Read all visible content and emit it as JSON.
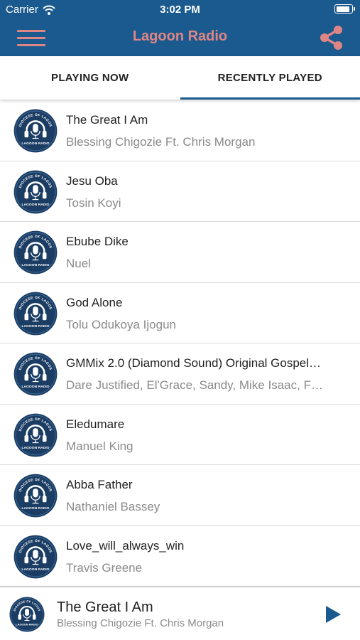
{
  "status_bar": {
    "carrier": "Carrier",
    "time": "3:02 PM"
  },
  "header": {
    "title": "Lagoon Radio",
    "menu_icon": "hamburger-menu-icon",
    "share_icon": "share-icon"
  },
  "colors": {
    "brand_blue": "#1b5a8e",
    "accent_pink": "#e08585",
    "avatar_navy": "#1b3c63"
  },
  "tabs": [
    {
      "label": "PLAYING NOW",
      "active": false
    },
    {
      "label": "RECENTLY PLAYED",
      "active": true
    }
  ],
  "tracks": [
    {
      "title": "The Great I Am",
      "artist": "Blessing Chigozie Ft. Chris Morgan"
    },
    {
      "title": "Jesu Oba",
      "artist": "Tosin Koyi"
    },
    {
      "title": "Ebube Dike",
      "artist": "Nuel"
    },
    {
      "title": "God Alone",
      "artist": "Tolu Odukoya Ijogun"
    },
    {
      "title": "GMMix 2.0 (Diamond Sound) Original Gospel…",
      "artist": "Dare Justified, El'Grace, Sandy, Mike Isaac, F…"
    },
    {
      "title": "Eledumare",
      "artist": "Manuel King"
    },
    {
      "title": "Abba Father",
      "artist": "Nathaniel Bassey"
    },
    {
      "title": "Love_will_always_win",
      "artist": "Travis Greene"
    }
  ],
  "now_playing": {
    "title": "The Great I Am",
    "artist": "Blessing Chigozie Ft. Chris Morgan",
    "play_icon": "play-icon"
  },
  "logo": {
    "top_text": "DIOCESE OF LAGOS",
    "bottom_text": "LAGOON RADIO"
  }
}
